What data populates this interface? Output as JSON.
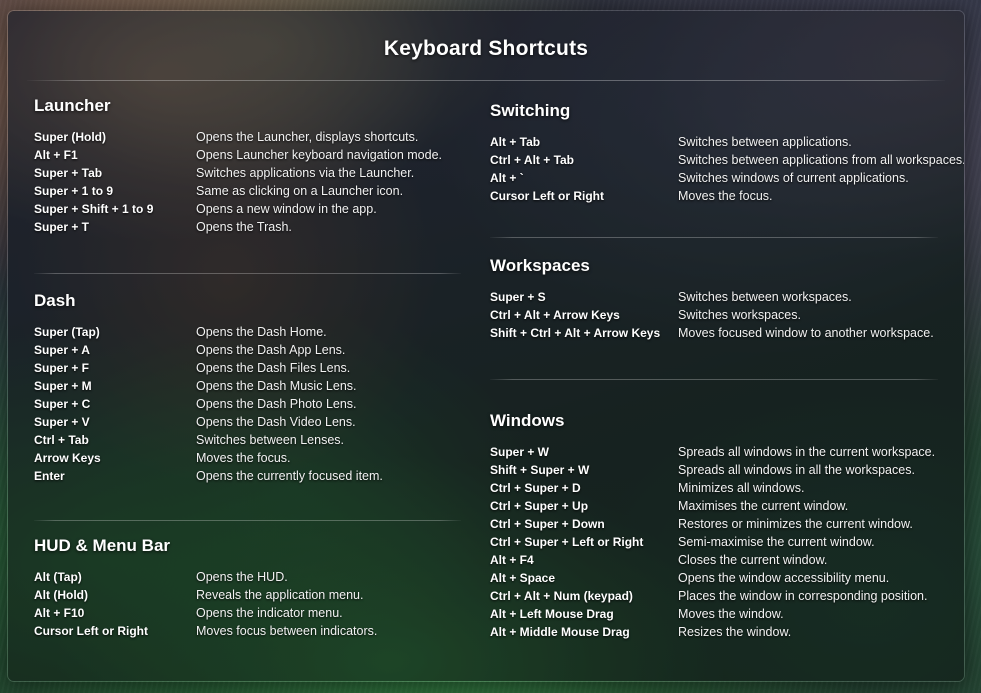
{
  "window": {
    "title": "Keyboard Shortcuts"
  },
  "colors": {
    "text_primary": "#ffffff",
    "text_secondary": "#f2f2f2",
    "overlay_border": "rgba(255,255,255,0.13)",
    "divider": "rgba(255,255,255,0.26)"
  },
  "columns": {
    "left": [
      {
        "title": "Launcher",
        "has_rule_above": false,
        "shortcuts": [
          {
            "key": "Super (Hold)",
            "description": "Opens the Launcher, displays shortcuts."
          },
          {
            "key": "Alt + F1",
            "description": "Opens Launcher keyboard navigation mode."
          },
          {
            "key": "Super + Tab",
            "description": "Switches applications via the Launcher."
          },
          {
            "key": "Super + 1 to 9",
            "description": "Same as clicking on a Launcher icon."
          },
          {
            "key": "Super + Shift + 1 to 9",
            "description": "Opens a new window in the app."
          },
          {
            "key": "Super + T",
            "description": "Opens the Trash."
          }
        ]
      },
      {
        "title": "Dash",
        "has_rule_above": true,
        "shortcuts": [
          {
            "key": "Super (Tap)",
            "description": "Opens the Dash Home."
          },
          {
            "key": "Super + A",
            "description": "Opens the Dash App Lens."
          },
          {
            "key": "Super + F",
            "description": "Opens the Dash Files Lens."
          },
          {
            "key": "Super + M",
            "description": "Opens the Dash Music Lens."
          },
          {
            "key": "Super + C",
            "description": "Opens the Dash Photo Lens."
          },
          {
            "key": "Super + V",
            "description": "Opens the Dash Video Lens."
          },
          {
            "key": "Ctrl + Tab",
            "description": "Switches between Lenses."
          },
          {
            "key": "Arrow Keys",
            "description": "Moves the focus."
          },
          {
            "key": "Enter",
            "description": "Opens the currently focused item."
          }
        ]
      },
      {
        "title": "HUD & Menu Bar",
        "has_rule_above": true,
        "shortcuts": [
          {
            "key": "Alt (Tap)",
            "description": "Opens the HUD."
          },
          {
            "key": "Alt (Hold)",
            "description": "Reveals the application menu."
          },
          {
            "key": "Alt + F10",
            "description": "Opens the indicator menu."
          },
          {
            "key": "Cursor Left or Right",
            "description": "Moves focus between indicators."
          }
        ]
      }
    ],
    "right": [
      {
        "title": "Switching",
        "has_rule_above": false,
        "shortcuts": [
          {
            "key": "Alt + Tab",
            "description": "Switches between applications."
          },
          {
            "key": "Ctrl + Alt + Tab",
            "description": "Switches between applications from all workspaces."
          },
          {
            "key": "Alt + `",
            "description": "Switches windows of current applications."
          },
          {
            "key": "Cursor Left or Right",
            "description": "Moves the focus."
          }
        ]
      },
      {
        "title": "Workspaces",
        "has_rule_above": true,
        "shortcuts": [
          {
            "key": "Super + S",
            "description": "Switches between workspaces."
          },
          {
            "key": "Ctrl + Alt + Arrow Keys",
            "description": "Switches workspaces."
          },
          {
            "key": "Shift + Ctrl + Alt + Arrow Keys",
            "description": "Moves focused window to another workspace."
          }
        ]
      },
      {
        "title": "Windows",
        "has_rule_above": true,
        "shortcuts": [
          {
            "key": "Super + W",
            "description": "Spreads all windows in the current workspace."
          },
          {
            "key": "Shift + Super + W",
            "description": "Spreads all windows in all the workspaces."
          },
          {
            "key": "Ctrl + Super + D",
            "description": "Minimizes all windows."
          },
          {
            "key": "Ctrl + Super + Up",
            "description": "Maximises the current window."
          },
          {
            "key": "Ctrl + Super + Down",
            "description": "Restores or minimizes the current window."
          },
          {
            "key": "Ctrl + Super + Left or Right",
            "description": "Semi-maximise the current window."
          },
          {
            "key": "Alt + F4",
            "description": "Closes the current window."
          },
          {
            "key": "Alt + Space",
            "description": "Opens the window accessibility menu."
          },
          {
            "key": "Ctrl + Alt + Num (keypad)",
            "description": "Places the window in corresponding position."
          },
          {
            "key": "Alt + Left Mouse Drag",
            "description": "Moves the window."
          },
          {
            "key": "Alt + Middle Mouse Drag",
            "description": "Resizes the window."
          }
        ]
      }
    ]
  },
  "layout": {
    "left_sections_top": [
      95,
      290,
      535
    ],
    "right_sections_top": [
      100,
      255,
      410
    ],
    "left_rules_y": [
      272,
      519
    ],
    "right_rules_y": [
      236,
      378
    ]
  }
}
